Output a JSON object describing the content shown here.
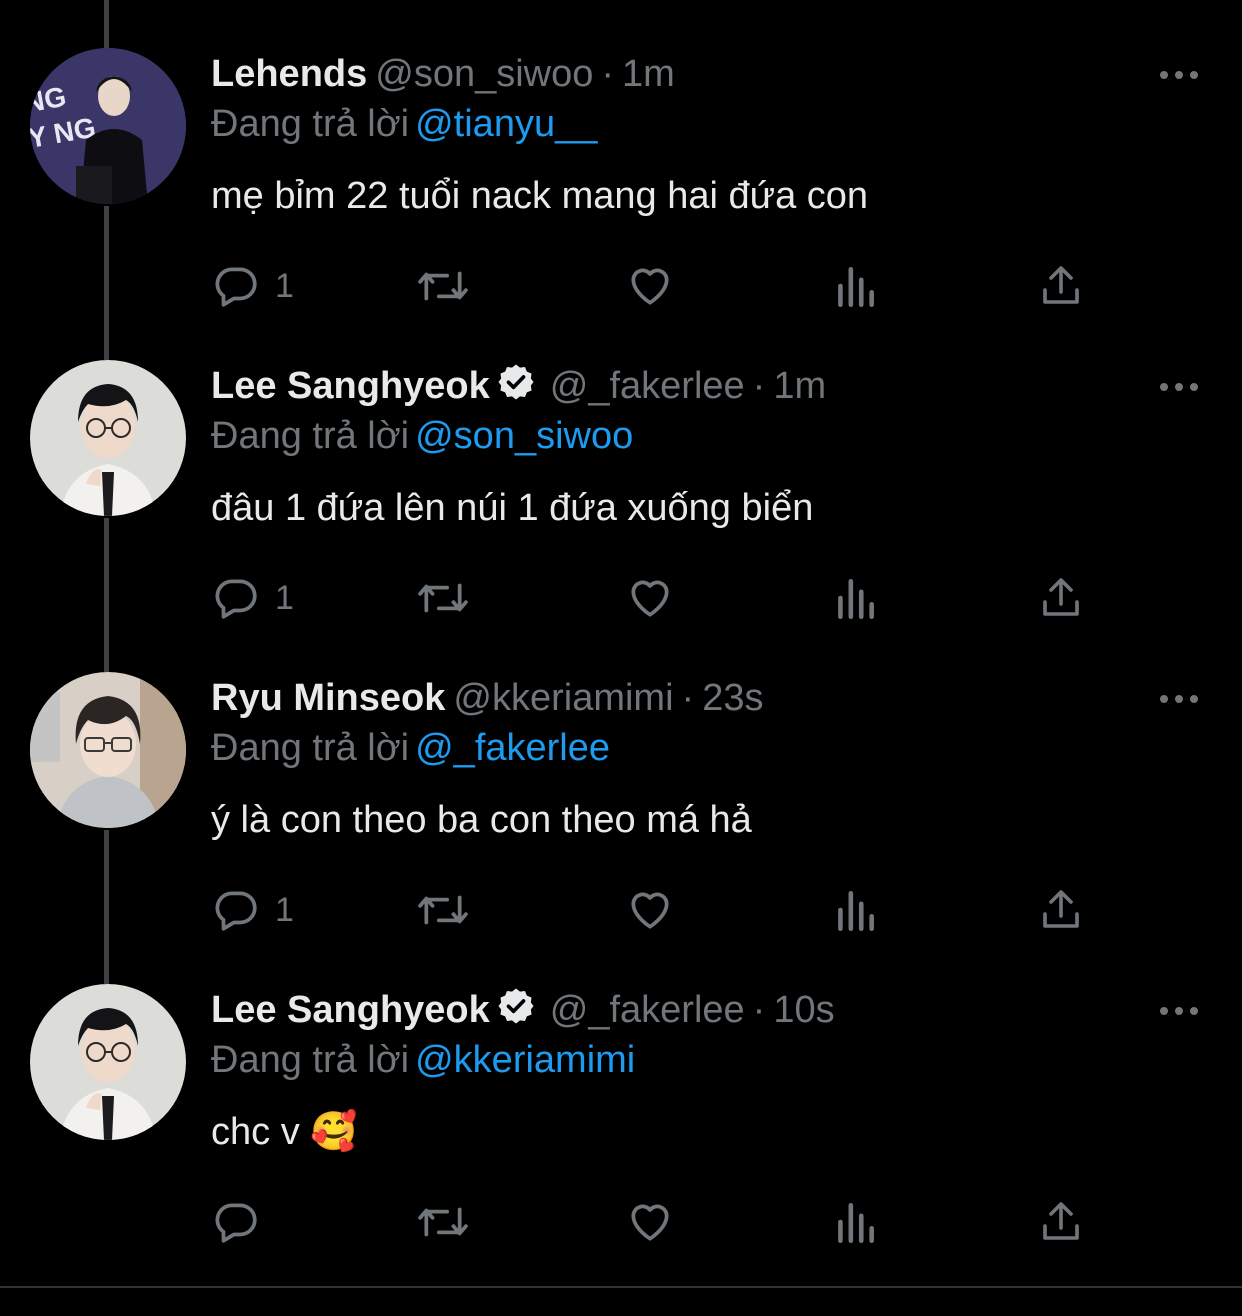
{
  "colors": {
    "accent": "#1d9bf0",
    "muted": "#71767b",
    "text": "#e7e9ea",
    "background": "#000000"
  },
  "reply_prefix": "Đang trả lời",
  "tweets": [
    {
      "name": "Lehends",
      "handle": "@son_siwoo",
      "separator": "·",
      "time": "1m",
      "verified": false,
      "reply_to": "@tianyu__",
      "text": "mẹ bỉm 22 tuổi nack mang hai đứa con",
      "reply_count": "1"
    },
    {
      "name": "Lee Sanghyeok",
      "handle": "@_fakerlee",
      "separator": "·",
      "time": "1m",
      "verified": true,
      "reply_to": "@son_siwoo",
      "text": "đâu 1 đứa lên núi 1 đứa xuống biển",
      "reply_count": "1"
    },
    {
      "name": "Ryu Minseok",
      "handle": "@kkeriamimi",
      "separator": "·",
      "time": "23s",
      "verified": false,
      "reply_to": "@_fakerlee",
      "text": "ý là con theo ba con theo má hả",
      "reply_count": "1"
    },
    {
      "name": "Lee Sanghyeok",
      "handle": "@_fakerlee",
      "separator": "·",
      "time": "10s",
      "verified": true,
      "reply_to": "@kkeriamimi",
      "text": "chc v 🥰",
      "reply_count": ""
    }
  ],
  "icons": {
    "reply": "reply-icon",
    "retweet": "retweet-icon",
    "like": "heart-icon",
    "views": "views-icon",
    "share": "share-icon",
    "more": "more-icon",
    "verified": "verified-badge-icon"
  }
}
